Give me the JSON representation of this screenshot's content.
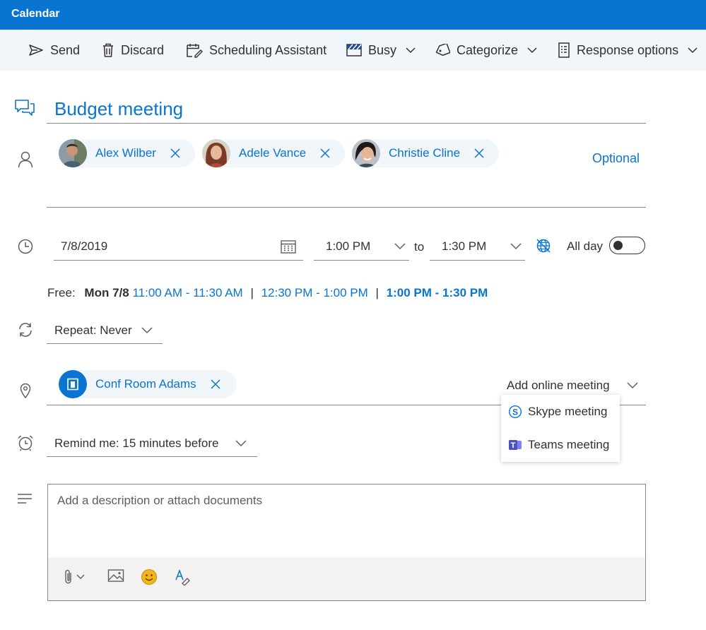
{
  "window": {
    "title": "Calendar"
  },
  "toolbar": {
    "send_label": "Send",
    "discard_label": "Discard",
    "scheduling_label": "Scheduling Assistant",
    "busy_label": "Busy",
    "categorize_label": "Categorize",
    "response_label": "Response options"
  },
  "event": {
    "title": "Budget meeting",
    "attendees": [
      {
        "name": "Alex Wilber"
      },
      {
        "name": "Adele Vance"
      },
      {
        "name": "Christie Cline"
      }
    ],
    "optional_label": "Optional",
    "date": "7/8/2019",
    "start_time": "1:00 PM",
    "to_label": "to",
    "end_time": "1:30 PM",
    "all_day_label": "All day",
    "all_day": false,
    "free": {
      "label": "Free:",
      "day": "Mon 7/8",
      "slots": [
        "11:00 AM - 11:30 AM",
        "12:30 PM - 1:00 PM"
      ],
      "separator": "|",
      "selected_slot": "1:00 PM - 1:30 PM"
    },
    "repeat": {
      "label": "Repeat:",
      "value": "Never"
    },
    "location": {
      "name": "Conf Room Adams"
    },
    "online_meeting": {
      "label": "Add online meeting",
      "options": [
        "Skype meeting",
        "Teams meeting"
      ]
    },
    "reminder": {
      "label": "Remind me:",
      "value": "15 minutes before"
    },
    "description_placeholder": "Add a description or attach documents"
  },
  "colors": {
    "accent": "#0a74d1",
    "toolbar_bg": "#f1f6fb",
    "chip_bg": "#f1f6fb",
    "text": "#323130",
    "divider": "#8a8886",
    "emoji": "#f4b41a",
    "teams": "#4b53bc"
  }
}
